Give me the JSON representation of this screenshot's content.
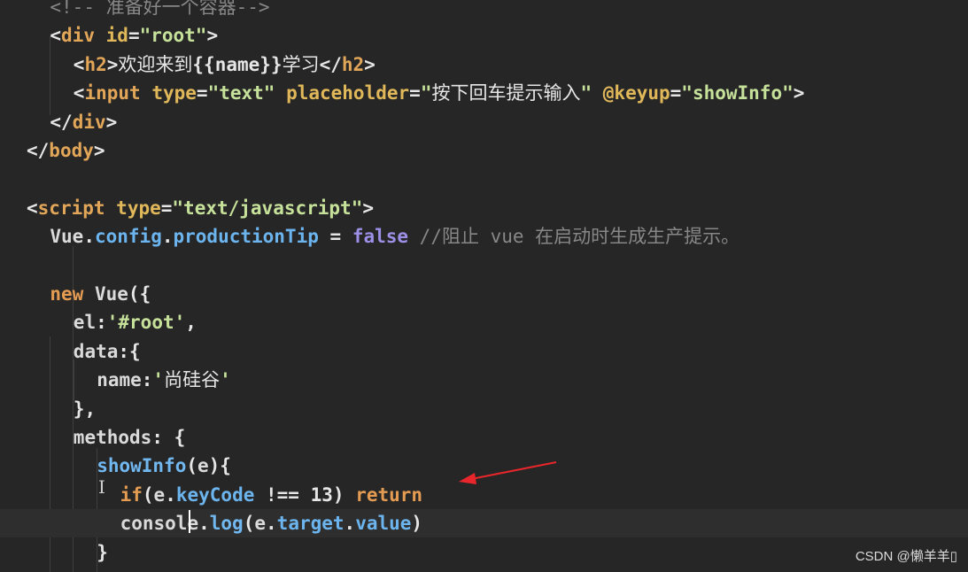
{
  "editor": {
    "lines": [
      {
        "indent": "  ",
        "tokens": [
          {
            "t": "<!-- 准备好一个容器-->",
            "c": "comment"
          }
        ]
      },
      {
        "indent": "  ",
        "tokens": [
          {
            "t": "<",
            "c": "punc"
          },
          {
            "t": "div",
            "c": "tag"
          },
          {
            "t": " ",
            "c": "punc"
          },
          {
            "t": "id",
            "c": "attr"
          },
          {
            "t": "=",
            "c": "punc"
          },
          {
            "t": "\"root\"",
            "c": "str"
          },
          {
            "t": ">",
            "c": "punc"
          }
        ]
      },
      {
        "indent": "    ",
        "tokens": [
          {
            "t": "<",
            "c": "punc"
          },
          {
            "t": "h2",
            "c": "tag"
          },
          {
            "t": ">",
            "c": "punc"
          },
          {
            "t": "欢迎来到",
            "c": "zh"
          },
          {
            "t": "{{name}}",
            "c": "punc"
          },
          {
            "t": "学习",
            "c": "zh"
          },
          {
            "t": "</",
            "c": "punc"
          },
          {
            "t": "h2",
            "c": "tag"
          },
          {
            "t": ">",
            "c": "punc"
          }
        ]
      },
      {
        "indent": "    ",
        "tokens": [
          {
            "t": "<",
            "c": "punc"
          },
          {
            "t": "input",
            "c": "tag"
          },
          {
            "t": " ",
            "c": "punc"
          },
          {
            "t": "type",
            "c": "attr"
          },
          {
            "t": "=",
            "c": "punc"
          },
          {
            "t": "\"text\"",
            "c": "str"
          },
          {
            "t": " ",
            "c": "punc"
          },
          {
            "t": "placeholder",
            "c": "attr"
          },
          {
            "t": "=",
            "c": "punc"
          },
          {
            "t": "\"",
            "c": "str"
          },
          {
            "t": "按下回车提示输入",
            "c": "zh"
          },
          {
            "t": "\"",
            "c": "str"
          },
          {
            "t": " ",
            "c": "punc"
          },
          {
            "t": "@keyup",
            "c": "attr"
          },
          {
            "t": "=",
            "c": "punc"
          },
          {
            "t": "\"showInfo\"",
            "c": "str"
          },
          {
            "t": ">",
            "c": "punc"
          }
        ]
      },
      {
        "indent": "  ",
        "tokens": [
          {
            "t": "</",
            "c": "punc"
          },
          {
            "t": "div",
            "c": "tag"
          },
          {
            "t": ">",
            "c": "punc"
          }
        ]
      },
      {
        "indent": "",
        "tokens": [
          {
            "t": "</",
            "c": "punc"
          },
          {
            "t": "body",
            "c": "tag"
          },
          {
            "t": ">",
            "c": "punc"
          }
        ]
      },
      {
        "indent": "",
        "tokens": []
      },
      {
        "indent": "",
        "tokens": [
          {
            "t": "<",
            "c": "punc"
          },
          {
            "t": "script",
            "c": "tag"
          },
          {
            "t": " ",
            "c": "punc"
          },
          {
            "t": "type",
            "c": "attr"
          },
          {
            "t": "=",
            "c": "punc"
          },
          {
            "t": "\"text/javascript\"",
            "c": "str"
          },
          {
            "t": ">",
            "c": "punc"
          }
        ]
      },
      {
        "indent": "  ",
        "tokens": [
          {
            "t": "Vue",
            "c": "ident"
          },
          {
            "t": ".",
            "c": "punc"
          },
          {
            "t": "config",
            "c": "prop"
          },
          {
            "t": ".",
            "c": "punc"
          },
          {
            "t": "productionTip",
            "c": "prop"
          },
          {
            "t": " = ",
            "c": "punc"
          },
          {
            "t": "false",
            "c": "bool"
          },
          {
            "t": " //阻止 vue 在启动时生成生产提示。",
            "c": "comment"
          }
        ]
      },
      {
        "indent": "",
        "tokens": []
      },
      {
        "indent": "  ",
        "tokens": [
          {
            "t": "new",
            "c": "kw"
          },
          {
            "t": " ",
            "c": "punc"
          },
          {
            "t": "Vue",
            "c": "ident"
          },
          {
            "t": "({",
            "c": "punc"
          }
        ]
      },
      {
        "indent": "    ",
        "tokens": [
          {
            "t": "el",
            "c": "key"
          },
          {
            "t": ":",
            "c": "punc"
          },
          {
            "t": "'#root'",
            "c": "str"
          },
          {
            "t": ",",
            "c": "punc"
          }
        ]
      },
      {
        "indent": "    ",
        "tokens": [
          {
            "t": "data",
            "c": "key"
          },
          {
            "t": ":{",
            "c": "punc"
          }
        ]
      },
      {
        "indent": "      ",
        "tokens": [
          {
            "t": "name",
            "c": "key"
          },
          {
            "t": ":",
            "c": "punc"
          },
          {
            "t": "'",
            "c": "str"
          },
          {
            "t": "尚硅谷",
            "c": "zh"
          },
          {
            "t": "'",
            "c": "str"
          }
        ]
      },
      {
        "indent": "    ",
        "tokens": [
          {
            "t": "},",
            "c": "punc"
          }
        ]
      },
      {
        "indent": "    ",
        "tokens": [
          {
            "t": "methods",
            "c": "key"
          },
          {
            "t": ": {",
            "c": "punc"
          }
        ]
      },
      {
        "indent": "      ",
        "tokens": [
          {
            "t": "showInfo",
            "c": "method"
          },
          {
            "t": "(",
            "c": "punc"
          },
          {
            "t": "e",
            "c": "ident"
          },
          {
            "t": "){",
            "c": "punc"
          }
        ]
      },
      {
        "indent": "        ",
        "tokens": [
          {
            "t": "if",
            "c": "kw"
          },
          {
            "t": "(",
            "c": "punc"
          },
          {
            "t": "e",
            "c": "ident"
          },
          {
            "t": ".",
            "c": "punc"
          },
          {
            "t": "keyCode",
            "c": "prop"
          },
          {
            "t": " !== ",
            "c": "punc"
          },
          {
            "t": "13",
            "c": "num"
          },
          {
            "t": ") ",
            "c": "punc"
          },
          {
            "t": "return",
            "c": "kw"
          }
        ]
      },
      {
        "indent": "        ",
        "current": true,
        "tokens": [
          {
            "t": "console",
            "c": "ident"
          },
          {
            "t": ".",
            "c": "punc"
          },
          {
            "t": "log",
            "c": "method"
          },
          {
            "t": "(",
            "c": "punc"
          },
          {
            "t": "e",
            "c": "ident"
          },
          {
            "t": ".",
            "c": "punc"
          },
          {
            "t": "target",
            "c": "prop"
          },
          {
            "t": ".",
            "c": "punc"
          },
          {
            "t": "value",
            "c": "prop"
          },
          {
            "t": ")",
            "c": "punc"
          }
        ]
      },
      {
        "indent": "      ",
        "tokens": [
          {
            "t": "}",
            "c": "punc"
          }
        ]
      }
    ]
  },
  "colors": {
    "background": "#262626",
    "annotation_arrow": "#e8262b"
  },
  "watermark": {
    "text": "CSDN @懒羊羊▯"
  }
}
